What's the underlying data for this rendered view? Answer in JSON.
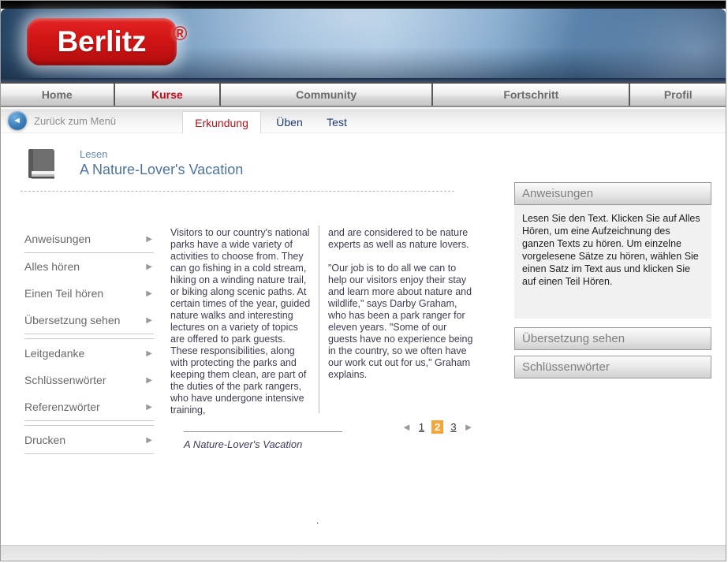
{
  "brand": {
    "logo_text": "Berlitz",
    "registered_mark": "®"
  },
  "nav": {
    "items": [
      {
        "label": "Home",
        "active": false
      },
      {
        "label": "Kurse",
        "active": true
      },
      {
        "label": "Community",
        "active": false
      },
      {
        "label": "Fortschritt",
        "active": false
      },
      {
        "label": "Profil",
        "active": false
      }
    ]
  },
  "subnav": {
    "back_label": "Zurück zum Menü",
    "back_icon": "◄",
    "tabs": [
      {
        "label": "Erkundung",
        "active": true
      },
      {
        "label": "Üben",
        "active": false
      },
      {
        "label": "Test",
        "active": false
      }
    ]
  },
  "page_header": {
    "kicker": "Lesen",
    "title": "A Nature-Lover's Vacation"
  },
  "left_menu": {
    "arrow_icon": "▶",
    "groups": [
      [
        "Anweisungen"
      ],
      [
        "Alles hören",
        "Einen Teil hören",
        "Übersetzung sehen"
      ],
      [
        "Leitgedanke",
        "Schlüssenwörter",
        "Referenzwörter"
      ],
      [
        "Drucken"
      ]
    ]
  },
  "reading": {
    "column1": "Visitors to our country's national parks have a wide variety of activities to choose from. They can go fishing in a cold stream, hiking on a winding nature trail, or biking along scenic paths. At certain times of the year, guided nature walks and interesting lectures on a variety of topics are offered to park guests. These responsibilities, along with protecting the parks and keeping them clean, are part of the duties of the park rangers, who have undergone intensive training,",
    "column2_p1": "and are considered to be nature experts as well as nature lovers.",
    "column2_p2": "\"Our job is to do all we can to help our visitors enjoy their stay and learn more about nature and wildlife,\" says Darby Graham, who has been a park ranger for eleven years. \"Some of our guests have no experience being in the country, so we often have our work cut out for us,\" Graham explains.",
    "caption": "A Nature-Lover's Vacation",
    "stray_dot": "."
  },
  "pagination": {
    "prev_icon": "◄",
    "next_icon": "►",
    "pages": [
      "1",
      "2",
      "3"
    ],
    "current_page": "2"
  },
  "right_panel": {
    "sections": [
      {
        "title": "Anweisungen",
        "body": "Lesen Sie den Text. Klicken Sie auf Alles Hören, um eine Aufzeichnung des ganzen Texts zu hören. Um einzelne vorgelesene Sätze zu hören, wählen Sie einen Satz im Text aus und klicken Sie auf einen Teil Hören."
      },
      {
        "title": "Übersetzung sehen",
        "body": ""
      },
      {
        "title": "Schlüssenwörter",
        "body": ""
      }
    ]
  },
  "colors": {
    "brand_red": "#d11515",
    "active_nav_red": "#c00a1e",
    "active_tab_red": "#b5121b",
    "tab_navy": "#1b3a75",
    "title_blue": "#4d74a1",
    "pagination_active_bg": "#f5a63b",
    "banner_blue_mid": "#8cb1d4",
    "panel_body_bg": "#f1f1f1"
  }
}
